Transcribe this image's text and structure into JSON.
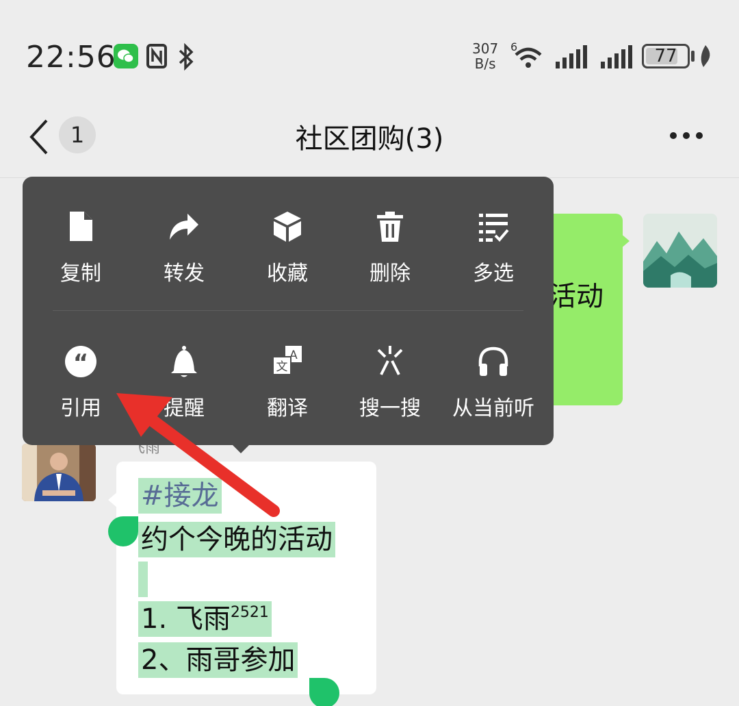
{
  "status_bar": {
    "time": "22:56",
    "net_speed_value": "307",
    "net_speed_unit": "B/s",
    "wifi_label": "6",
    "battery": "77"
  },
  "header": {
    "unread_count": "1",
    "title": "社区团购(3)"
  },
  "context_menu": {
    "row1": [
      {
        "label": "复制",
        "icon": "copy-icon"
      },
      {
        "label": "转发",
        "icon": "forward-icon"
      },
      {
        "label": "收藏",
        "icon": "favorite-icon"
      },
      {
        "label": "删除",
        "icon": "delete-icon"
      },
      {
        "label": "多选",
        "icon": "multi-select-icon"
      }
    ],
    "row2": [
      {
        "label": "引用",
        "icon": "quote-icon"
      },
      {
        "label": "提醒",
        "icon": "bell-icon"
      },
      {
        "label": "翻译",
        "icon": "translate-icon"
      },
      {
        "label": "搜一搜",
        "icon": "search-sparkle-icon"
      },
      {
        "label": "从当前听",
        "icon": "headphones-icon"
      }
    ]
  },
  "messages": {
    "outgoing_partial_text": "活动",
    "sender_name": "飞雨",
    "incoming": {
      "hashtag": "#接龙",
      "line2": "约个今晚的活动",
      "line4_text": "1. 飞雨",
      "line4_sup": "2521",
      "line5": "2、雨哥参加"
    }
  },
  "colors": {
    "menu_bg": "#4c4c4c",
    "outgoing_bubble": "#95ec69",
    "selection_highlight": "#b5e7c3",
    "selection_handle": "#1fc26a",
    "annotation_arrow": "#e8302a"
  }
}
